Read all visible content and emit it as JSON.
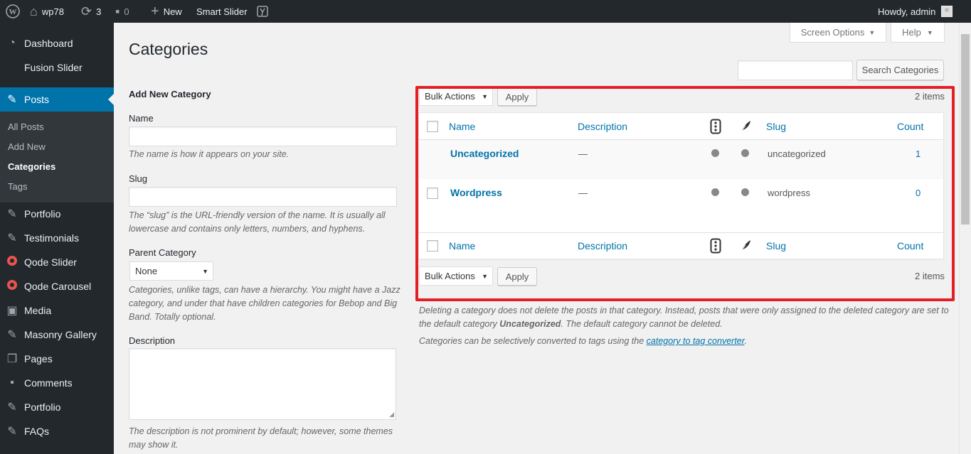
{
  "adminbar": {
    "site_name": "wp78",
    "updates_count": "3",
    "comments_count": "0",
    "new_label": "New",
    "plugin_label": "Smart Slider",
    "howdy": "Howdy, admin"
  },
  "sidebar": {
    "items": [
      {
        "label": "Dashboard",
        "icon": "dashboard-icon"
      },
      {
        "label": "Fusion Slider",
        "icon": ""
      },
      {
        "label": "Posts",
        "icon": "pin-icon"
      },
      {
        "label": "Portfolio",
        "icon": "pin-icon"
      },
      {
        "label": "Testimonials",
        "icon": "pin-icon"
      },
      {
        "label": "Qode Slider",
        "icon": "qode-icon"
      },
      {
        "label": "Qode Carousel",
        "icon": "qode-icon"
      },
      {
        "label": "Media",
        "icon": "media-icon"
      },
      {
        "label": "Masonry Gallery",
        "icon": "pin-icon"
      },
      {
        "label": "Pages",
        "icon": "pages-icon"
      },
      {
        "label": "Comments",
        "icon": "comments-icon"
      },
      {
        "label": "Portfolio",
        "icon": "pin-icon"
      },
      {
        "label": "FAQs",
        "icon": "pin-icon"
      }
    ],
    "submenu": [
      "All Posts",
      "Add New",
      "Categories",
      "Tags"
    ]
  },
  "header": {
    "screen_options": "Screen Options",
    "help": "Help",
    "title": "Categories",
    "search_button": "Search Categories",
    "search_value": ""
  },
  "form": {
    "heading": "Add New Category",
    "name_label": "Name",
    "name_hint": "The name is how it appears on your site.",
    "slug_label": "Slug",
    "slug_hint": "The “slug” is the URL-friendly version of the name. It is usually all lowercase and contains only letters, numbers, and hyphens.",
    "parent_label": "Parent Category",
    "parent_value": "None",
    "parent_hint": "Categories, unlike tags, can have a hierarchy. You might have a Jazz category, and under that have children categories for Bebop and Big Band. Totally optional.",
    "description_label": "Description",
    "description_hint": "The description is not prominent by default; however, some themes may show it."
  },
  "table": {
    "bulk_actions": "Bulk Actions",
    "apply": "Apply",
    "items_count": "2 items",
    "columns": [
      "Name",
      "Description",
      "Slug",
      "Count"
    ],
    "rows": [
      {
        "name": "Uncategorized",
        "description": "—",
        "slug": "uncategorized",
        "count": "1"
      },
      {
        "name": "Wordpress",
        "description": "—",
        "slug": "wordpress",
        "count": "0"
      }
    ]
  },
  "notes": {
    "note1_a": "Deleting a category does not delete the posts in that category. Instead, posts that were only assigned to the deleted category are set to the default category ",
    "note1_b": "Uncategorized",
    "note1_c": ". The default category cannot be deleted.",
    "note2_a": "Categories can be selectively converted to tags using the ",
    "note2_link": "category to tag converter",
    "note2_c": "."
  },
  "colors": {
    "accent": "#0073aa",
    "highlight": "#e31e25",
    "adminbar": "#23282d"
  }
}
